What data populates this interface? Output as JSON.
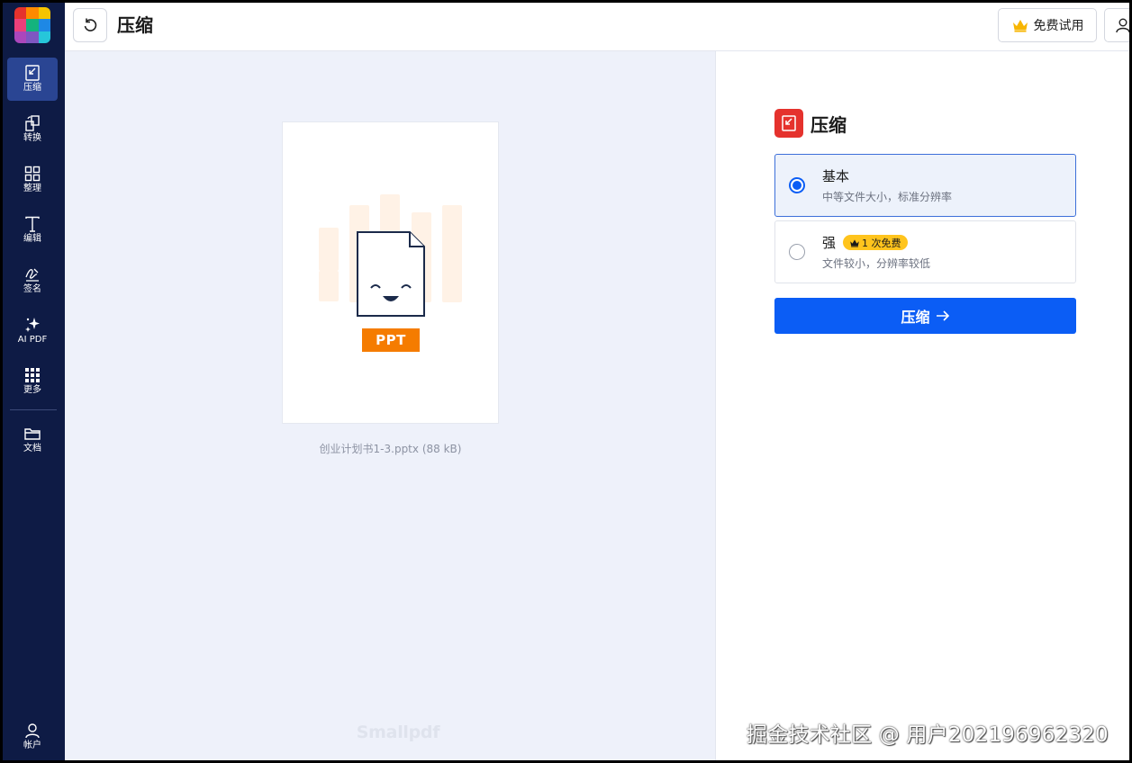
{
  "app": {
    "logo_colors": [
      "#e5322d",
      "#ff8a00",
      "#f5c400",
      "#14b37d",
      "#1e88e5",
      "#7e57c2",
      "#ec407a",
      "#ab47bc",
      "#26c6da"
    ]
  },
  "sidebar": {
    "items": [
      {
        "id": "compress",
        "label": "压缩",
        "icon": "compress-icon",
        "active": true
      },
      {
        "id": "convert",
        "label": "转换",
        "icon": "convert-icon",
        "active": false
      },
      {
        "id": "organize",
        "label": "整理",
        "icon": "grid-icon",
        "active": false
      },
      {
        "id": "edit",
        "label": "编辑",
        "icon": "text-icon",
        "active": false
      },
      {
        "id": "sign",
        "label": "签名",
        "icon": "signature-icon",
        "active": false
      },
      {
        "id": "ai",
        "label": "AI PDF",
        "icon": "sparkle-icon",
        "active": false
      },
      {
        "id": "more",
        "label": "更多",
        "icon": "dots-grid-icon",
        "active": false
      }
    ],
    "docs_label": "文档",
    "account_label": "帐户"
  },
  "topbar": {
    "title": "压缩",
    "trial_label": "免费试用"
  },
  "preview": {
    "file_type": "PPT",
    "file_name": "创业计划书1-3.pptx",
    "file_size": "(88 kB)",
    "brand_watermark": "Smallpdf",
    "badge_color": "#f57c00"
  },
  "panel": {
    "title": "压缩",
    "options": [
      {
        "title": "基本",
        "desc": "中等文件大小，标准分辨率",
        "selected": true
      },
      {
        "title": "强",
        "desc": "文件较小，分辨率较低",
        "selected": false,
        "badge": "1 次免费"
      }
    ],
    "action_label": "压缩",
    "accent_color": "#0b5df5"
  },
  "overlay": {
    "site_watermark": "掘金技术社区 @ 用户202196962320"
  }
}
